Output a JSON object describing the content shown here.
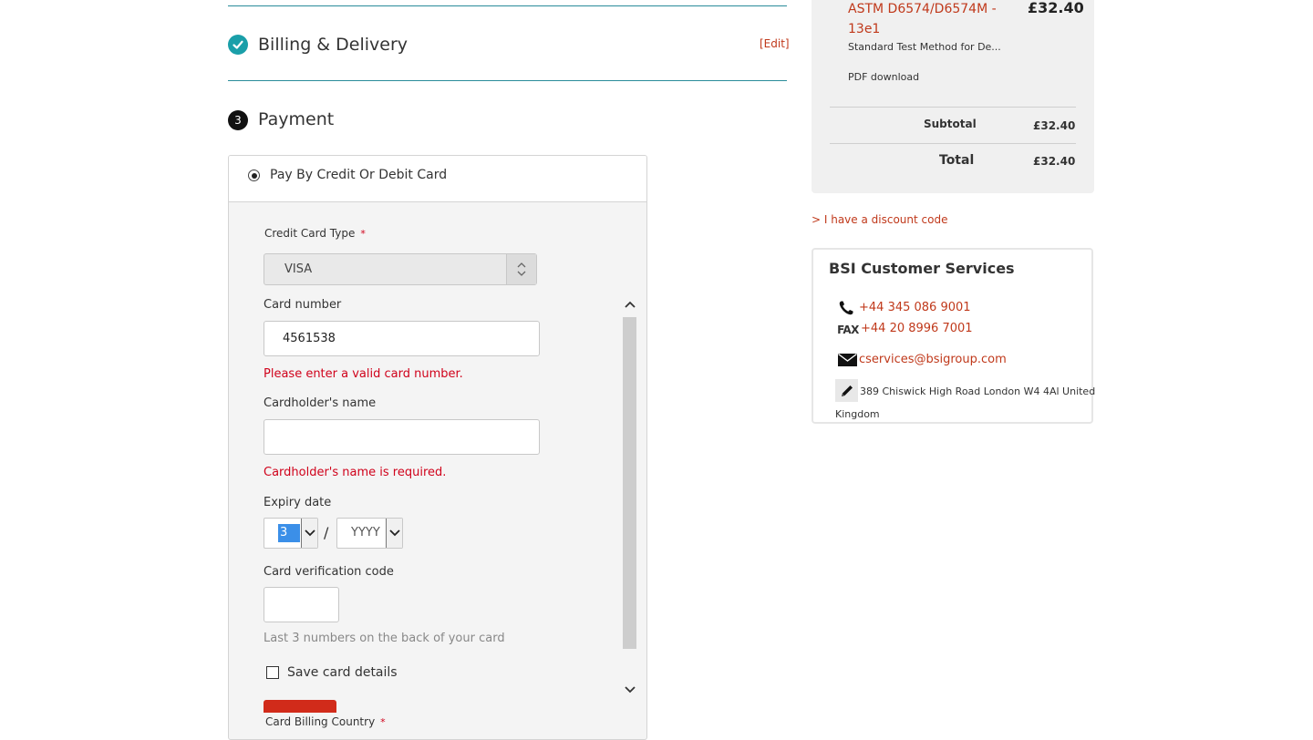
{
  "steps": {
    "billing": {
      "title": "Billing & Delivery",
      "edit_label": "[Edit]"
    },
    "payment": {
      "number": "3",
      "title": "Payment"
    }
  },
  "payment_method": {
    "label": "Pay By Credit Or Debit Card",
    "selected": true
  },
  "form": {
    "card_type": {
      "label": "Credit Card Type",
      "required_mark": "*",
      "value": "VISA"
    },
    "card_number": {
      "label": "Card number",
      "value": "4561538",
      "error": "Please enter a valid card number."
    },
    "cardholder": {
      "label": "Cardholder's name",
      "value": "",
      "error": "Cardholder's name is required."
    },
    "expiry": {
      "label": "Expiry date",
      "month": "3",
      "separator": "/",
      "year": "YYYY"
    },
    "cvc": {
      "label": "Card verification code",
      "value": "",
      "hint": "Last 3 numbers on the back of your card"
    },
    "save_card": {
      "label": "Save card details",
      "checked": false
    },
    "billing_country": {
      "label": "Card Billing Country",
      "required_mark": "*"
    }
  },
  "order_summary": {
    "product": {
      "name": "ASTM D6574/D6574M - 13e1",
      "price": "£32.40",
      "description": "Standard Test Method for De...",
      "format": "PDF download"
    },
    "subtotal": {
      "label": "Subtotal",
      "value": "£32.40"
    },
    "total": {
      "label": "Total",
      "value": "£32.40"
    }
  },
  "discount": {
    "label": "> I have a discount code"
  },
  "customer_services": {
    "title": "BSI Customer Services",
    "phone": "+44 345 086 9001",
    "fax_label": "FAX",
    "fax": "+44 20 8996 7001",
    "email": "cservices@bsigroup.com",
    "address_line1": "389 Chiswick High Road London W4 4Al United",
    "address_line2": "Kingdom"
  },
  "colors": {
    "accent_teal": "#1a9fa9",
    "link_red": "#c0391b",
    "error_red": "#d0021b"
  }
}
